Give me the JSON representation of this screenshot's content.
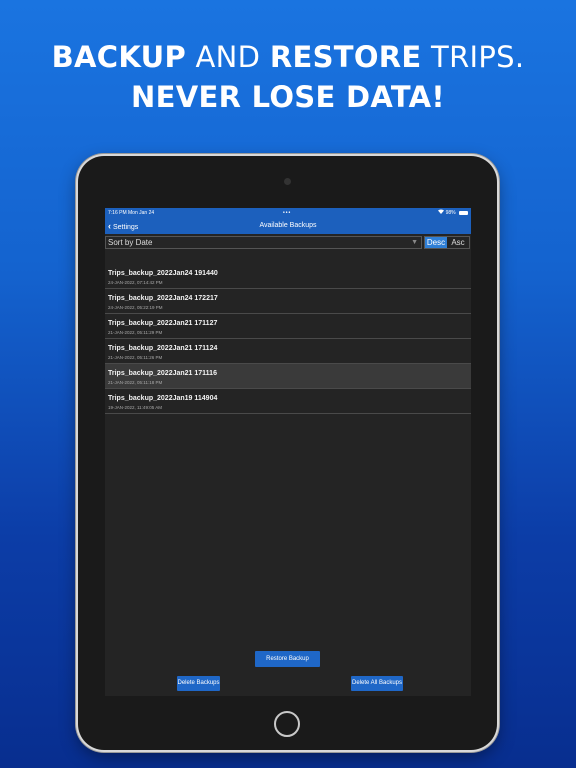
{
  "headline": {
    "line1_bold1": "BACKUP",
    "line1_light1": " AND ",
    "line1_bold2": "RESTORE",
    "line1_light2": " TRIPS.",
    "line2": "NEVER LOSE DATA!"
  },
  "status_bar": {
    "time_date": "7:16 PM   Mon Jan 24",
    "dots": "•••",
    "battery_text": "98%"
  },
  "nav": {
    "back_label": "Settings",
    "title": "Available Backups"
  },
  "sort": {
    "selected": "Sort by Date",
    "desc": "Desc",
    "asc": "Asc",
    "active_order": "Desc"
  },
  "backups": [
    {
      "name": "Trips_backup_2022Jan24 191440",
      "date": "24-JAN-2022, 07:14:42 PM"
    },
    {
      "name": "Trips_backup_2022Jan24 172217",
      "date": "24-JAN-2022, 05:22:19 PM"
    },
    {
      "name": "Trips_backup_2022Jan21 171127",
      "date": "21-JAN-2022, 05:11:29 PM"
    },
    {
      "name": "Trips_backup_2022Jan21 171124",
      "date": "21-JAN-2022, 05:11:26 PM"
    },
    {
      "name": "Trips_backup_2022Jan21 171116",
      "date": "21-JAN-2022, 05:11:18 PM"
    },
    {
      "name": "Trips_backup_2022Jan19 114904",
      "date": "19-JAN-2022, 11:49:05 AM"
    }
  ],
  "selected_index": 4,
  "buttons": {
    "restore": "Restore Backup",
    "delete": "Delete Backups",
    "delete_all": "Delete All Backups"
  },
  "colors": {
    "accent": "#1f67c7",
    "navbar": "#1c60bd",
    "background_top": "#1a74e0",
    "background_bottom": "#082e8f"
  },
  "icons": {
    "back": "chevron-left-icon",
    "sort_dropdown": "caret-down-icon",
    "wifi": "wifi-icon",
    "battery": "battery-icon"
  }
}
